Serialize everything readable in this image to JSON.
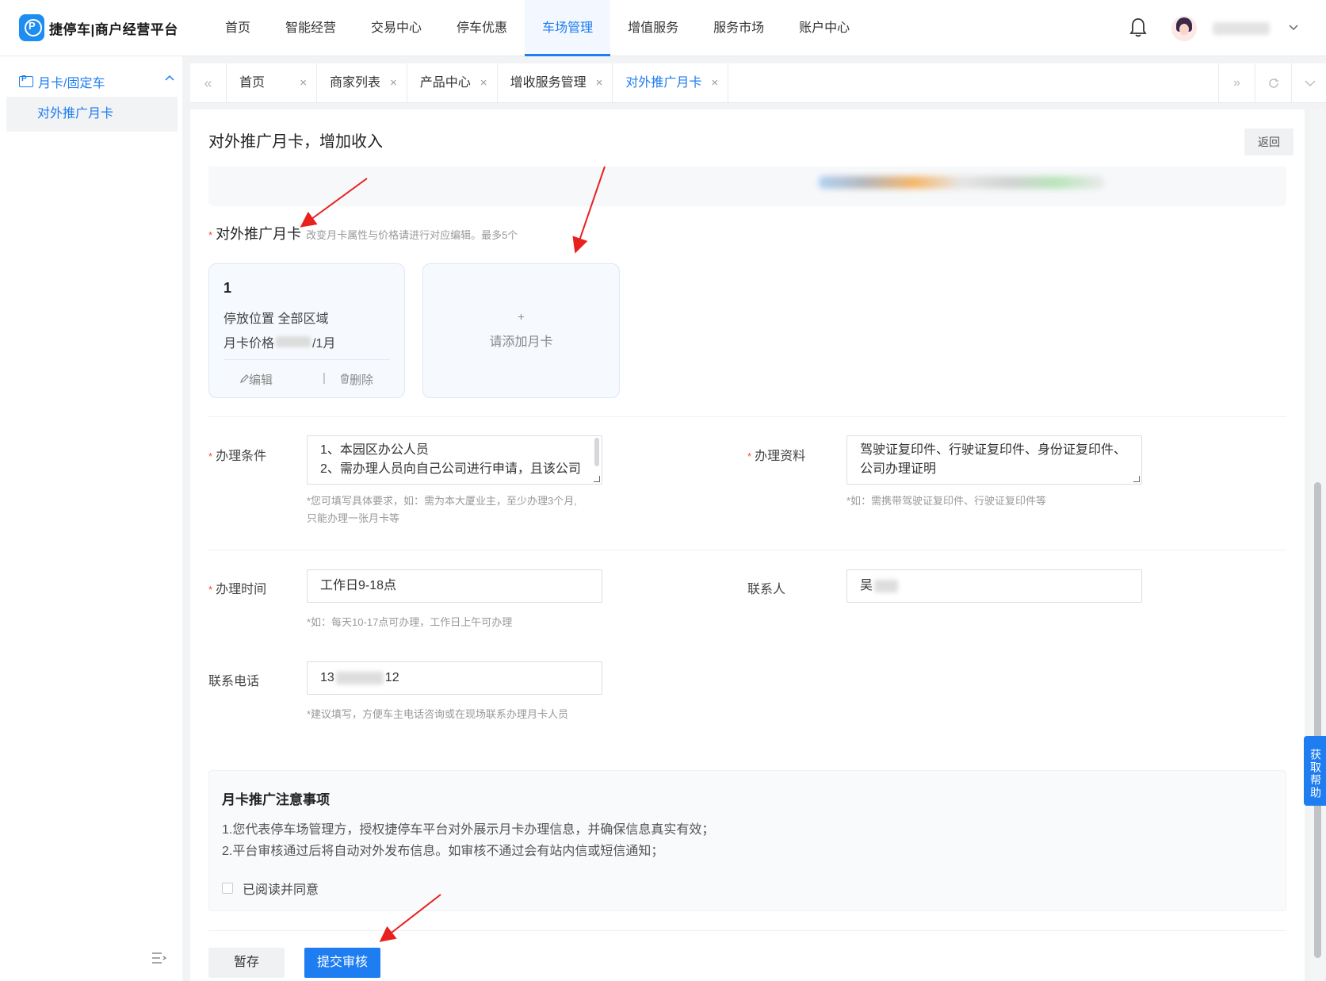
{
  "brand": {
    "logo_glyph": "P",
    "name": "捷停车|商户经营平台"
  },
  "nav": [
    {
      "label": "首页"
    },
    {
      "label": "智能经营"
    },
    {
      "label": "交易中心"
    },
    {
      "label": "停车优惠"
    },
    {
      "label": "车场管理",
      "active": true
    },
    {
      "label": "增值服务"
    },
    {
      "label": "服务市场"
    },
    {
      "label": "账户中心"
    }
  ],
  "sidebar": {
    "group_label": "月卡/固定车",
    "item_label": "对外推广月卡"
  },
  "tabs": [
    {
      "label": "首页"
    },
    {
      "label": "商家列表"
    },
    {
      "label": "产品中心"
    },
    {
      "label": "增收服务管理"
    },
    {
      "label": "对外推广月卡",
      "active": true
    }
  ],
  "tab_close_glyph": "×",
  "page": {
    "title": "对外推广月卡，增加收入",
    "back_label": "返回"
  },
  "monthly_section": {
    "required_mark": "*",
    "label": "对外推广月卡",
    "hint": "改变月卡属性与价格请进行对应编辑。最多5个"
  },
  "monthly_card": {
    "index": "1",
    "location_text": "停放位置  全部区域",
    "price_prefix": "月卡价格",
    "price_suffix": "/1月",
    "edit_label": "编辑",
    "separator": "|",
    "delete_label": "删除"
  },
  "add_card": {
    "plus": "+",
    "label": "请添加月卡"
  },
  "form": {
    "conditions": {
      "label": "办理条件",
      "line1": "1、本园区办公人员",
      "line2": "2、需办理人员向自己公司进行申请，且该公司",
      "hint1": "*您可填写具体要求，如：需为本大厦业主，至少办理3个月,",
      "hint2": "只能办理一张月卡等"
    },
    "materials": {
      "label": "办理资料",
      "line1": "驾驶证复印件、行驶证复印件、身份证复印件、",
      "line2": "公司办理证明",
      "hint": "*如：需携带驾驶证复印件、行驶证复印件等"
    },
    "time": {
      "label": "办理时间",
      "value": "工作日9-18点",
      "hint": "*如：每天10-17点可办理，工作日上午可办理"
    },
    "contact": {
      "label": "联系人",
      "value_prefix": "吴"
    },
    "phone": {
      "label": "联系电话",
      "value_prefix": "13",
      "value_suffix": "12",
      "hint": "*建议填写，方便车主电话咨询或在现场联系办理月卡人员"
    }
  },
  "notice": {
    "title": "月卡推广注意事项",
    "line1": "1.您代表停车场管理方，授权捷停车平台对外展示月卡办理信息，并确保信息真实有效；",
    "line2": "2.平台审核通过后将自动对外发布信息。如审核不通过会有站内信或短信通知；",
    "agree_label": "已阅读并同意"
  },
  "actions": {
    "save_label": "暂存",
    "submit_label": "提交审核"
  },
  "help_tab": "获取帮助",
  "colors": {
    "accent": "#1e7df0",
    "required": "#f04a4a",
    "annotation_arrow": "#e8211f"
  },
  "icons": {
    "bell": "bell-icon",
    "avatar": "avatar",
    "chevron": "chevron-down-icon",
    "collapse": "menu-collapse-icon",
    "edit": "pencil-icon",
    "delete": "trash-icon"
  }
}
